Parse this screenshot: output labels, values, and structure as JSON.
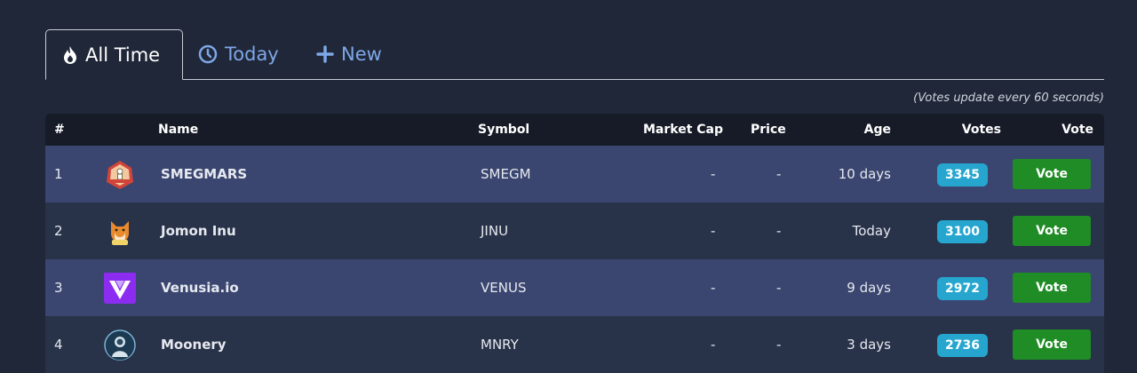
{
  "tabs": [
    {
      "label": "All Time",
      "icon": "fire-icon",
      "active": true
    },
    {
      "label": "Today",
      "icon": "clock-icon",
      "active": false
    },
    {
      "label": "New",
      "icon": "plus-icon",
      "active": false
    }
  ],
  "note": "(Votes update every 60 seconds)",
  "table": {
    "headers": {
      "num": "#",
      "name": "Name",
      "symbol": "Symbol",
      "market_cap": "Market Cap",
      "price": "Price",
      "age": "Age",
      "votes": "Votes",
      "vote": "Vote"
    },
    "rows": [
      {
        "num": "1",
        "logo": "smegmars-logo",
        "name": "SMEGMARS",
        "symbol": "SMEGM",
        "market_cap": "-",
        "price": "-",
        "age": "10 days",
        "votes": "3345",
        "vote_label": "Vote"
      },
      {
        "num": "2",
        "logo": "jomon-inu-logo",
        "name": "Jomon Inu",
        "symbol": "JINU",
        "market_cap": "-",
        "price": "-",
        "age": "Today",
        "votes": "3100",
        "vote_label": "Vote"
      },
      {
        "num": "3",
        "logo": "venusia-logo",
        "name": "Venusia.io",
        "symbol": "VENUS",
        "market_cap": "-",
        "price": "-",
        "age": "9 days",
        "votes": "2972",
        "vote_label": "Vote"
      },
      {
        "num": "4",
        "logo": "moonery-logo",
        "name": "Moonery",
        "symbol": "MNRY",
        "market_cap": "-",
        "price": "-",
        "age": "3 days",
        "votes": "2736",
        "vote_label": "Vote"
      }
    ]
  },
  "colors": {
    "background": "#202738",
    "row_odd": "#3a4670",
    "row_even": "#283249",
    "badge": "#26a6cf",
    "vote_button": "#1f8c25",
    "tab_link": "#7ea7e8"
  }
}
